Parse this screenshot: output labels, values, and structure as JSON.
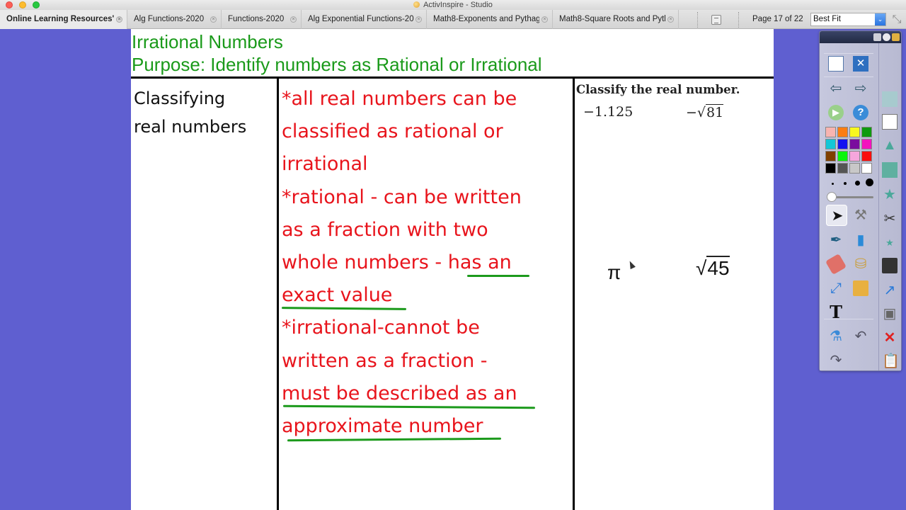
{
  "window": {
    "title": "ActivInspire - Studio"
  },
  "tabs": [
    {
      "label": "Online Learning Resources'",
      "active": true
    },
    {
      "label": "Alg Functions-2020",
      "active": false
    },
    {
      "label": "Functions-2020",
      "active": false
    },
    {
      "label": "Alg Exponential Functions-20:",
      "active": false
    },
    {
      "label": "Math8-Exponents and Pythag",
      "active": false
    },
    {
      "label": "Math8-Square Roots and Pytl",
      "active": false
    }
  ],
  "toolbar": {
    "page_indicator": "Page 17 of 22",
    "zoom_value": "Best Fit",
    "close_tab_glyph": "×",
    "dropdown_glyph": "⌄",
    "fullscreen_glyph": "⤡"
  },
  "flipchart": {
    "title": "Irrational Numbers",
    "purpose": "Purpose: Identify numbers as Rational or Irrational",
    "left_cell": [
      "Classifying",
      "real numbers"
    ],
    "notes": [
      {
        "text": "*all real numbers can be",
        "underlined": false
      },
      {
        "text": "classified as rational or",
        "underlined": false
      },
      {
        "text": "irrational",
        "underlined": false
      },
      {
        "text": "*rational - can be written",
        "underlined": false
      },
      {
        "text": "as a fraction with two",
        "underlined": false
      },
      {
        "pre": "whole numbers - ",
        "emph": "has an",
        "underlined": true
      },
      {
        "text": "exact value",
        "underlined": true
      },
      {
        "text": "*irrational-cannot be",
        "underlined": false
      },
      {
        "text": "written as a fraction -",
        "underlined": false
      },
      {
        "text": "must be described as an",
        "underlined": true
      },
      {
        "text": "approximate number",
        "underlined": true
      }
    ],
    "exercise": {
      "heading": "Classify the real number.",
      "items": [
        {
          "minus": "−",
          "value": "1.125",
          "radical": false
        },
        {
          "minus": "−",
          "radical_sign": "√",
          "value": "81",
          "radical": true
        },
        {
          "value": "π",
          "radical": false
        },
        {
          "radical_sign": "√",
          "value": "45",
          "radical": true
        }
      ]
    }
  },
  "toolbox": {
    "colors": [
      "#f8b4b0",
      "#fb7d12",
      "#f8f81e",
      "#0e9a0e",
      "#13c6d6",
      "#1212f0",
      "#7a0c9e",
      "#f312be",
      "#804000",
      "#0af50a",
      "#f6a6dc",
      "#fa0e0e",
      "#000000",
      "#555555",
      "#c8c8c8",
      "#ffffff"
    ],
    "tools": [
      "main-menu",
      "settings",
      "previous-page",
      "next-page",
      "play",
      "help",
      "select",
      "multi-tools",
      "pen",
      "highlighter",
      "eraser",
      "fill",
      "connector",
      "resource-library",
      "text",
      "clear",
      "undo",
      "redo"
    ],
    "side_tools": [
      "shape-group",
      "duplicate",
      "shape",
      "overlap",
      "shapes-star",
      "cut",
      "favorites",
      "save",
      "reveal",
      "camera",
      "delete",
      "paste"
    ]
  }
}
